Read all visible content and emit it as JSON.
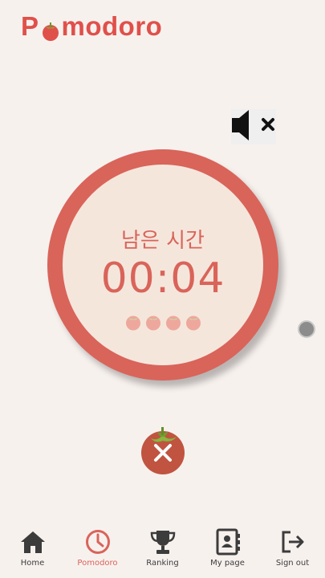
{
  "app": {
    "logo_prefix": "P",
    "logo_suffix": "modoro"
  },
  "sound": {
    "icon": "speaker-mute-icon"
  },
  "timer": {
    "label": "남은 시간",
    "time": "00:04",
    "completed_tomatoes": 4
  },
  "controls": {
    "stop_icon": "close-icon"
  },
  "colors": {
    "primary": "#d9645a",
    "logo": "#e0504a",
    "background": "#f7f1ee",
    "timer_face": "#f5e6dc"
  },
  "nav": {
    "items": [
      {
        "label": "Home",
        "icon": "home-icon"
      },
      {
        "label": "Pomodoro",
        "icon": "clock-icon",
        "active": true
      },
      {
        "label": "Ranking",
        "icon": "trophy-icon"
      },
      {
        "label": "My page",
        "icon": "contact-book-icon"
      },
      {
        "label": "Sign out",
        "icon": "sign-out-icon"
      }
    ]
  }
}
